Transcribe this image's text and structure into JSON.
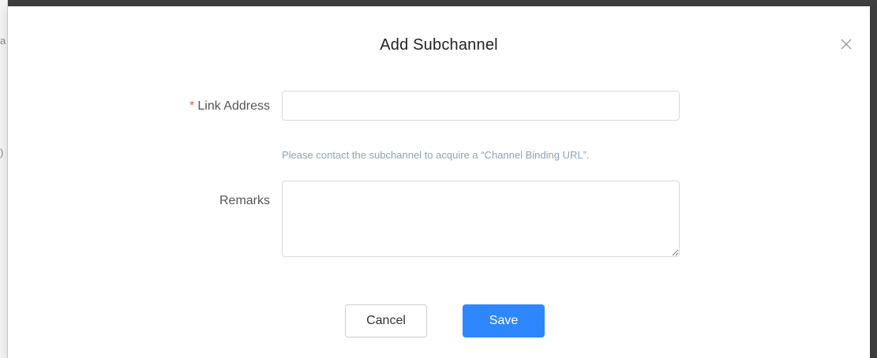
{
  "dialog": {
    "title": "Add Subchannel",
    "close_icon": "close-icon"
  },
  "form": {
    "link_address": {
      "required_mark": "*",
      "label": "Link Address",
      "value": "",
      "placeholder": ""
    },
    "hint": "Please contact the subchannel to acquire a “Channel Binding URL”.",
    "remarks": {
      "label": "Remarks",
      "value": "",
      "placeholder": ""
    }
  },
  "actions": {
    "cancel_label": "Cancel",
    "save_label": "Save"
  },
  "background": {
    "fragments": [
      "a",
      ")"
    ]
  },
  "colors": {
    "primary": "#2f87ff",
    "required": "#e5574f",
    "hint": "#8fa3b5"
  }
}
